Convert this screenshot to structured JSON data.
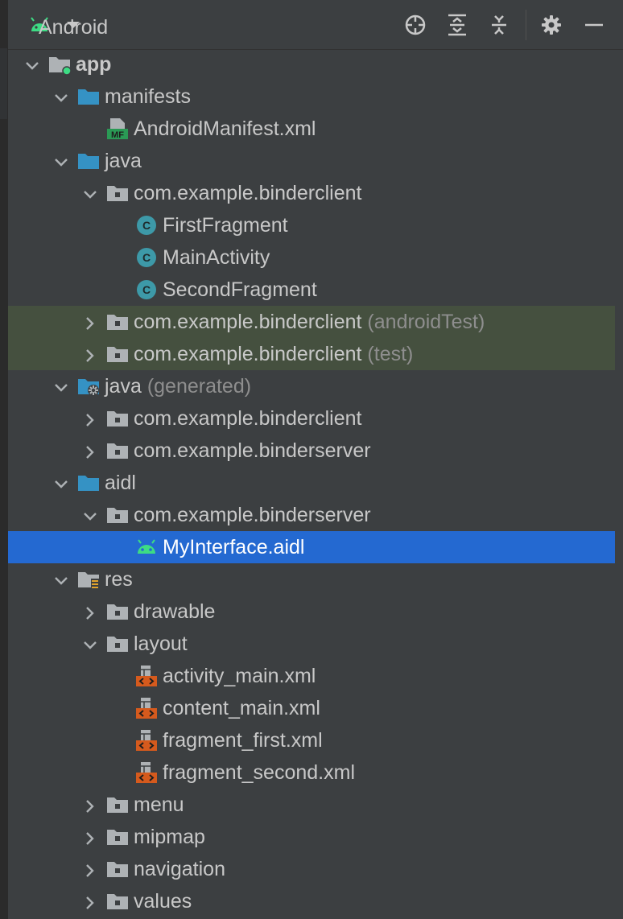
{
  "toolbar": {
    "view_label": "Android",
    "icons": [
      "locate-icon",
      "expand-all-icon",
      "collapse-all-icon",
      "gear-icon",
      "minimize-icon"
    ]
  },
  "tree": [
    {
      "label": "app",
      "suffix": "",
      "depth": 0,
      "toggle": "expanded",
      "icon": "module",
      "bold": true
    },
    {
      "label": "manifests",
      "suffix": "",
      "depth": 1,
      "toggle": "expanded",
      "icon": "folder"
    },
    {
      "label": "AndroidManifest.xml",
      "suffix": "",
      "depth": 2,
      "toggle": "none",
      "icon": "manifest"
    },
    {
      "label": "java",
      "suffix": "",
      "depth": 1,
      "toggle": "expanded",
      "icon": "folder"
    },
    {
      "label": "com.example.binderclient",
      "suffix": "",
      "depth": 2,
      "toggle": "expanded",
      "icon": "package"
    },
    {
      "label": "FirstFragment",
      "suffix": "",
      "depth": 3,
      "toggle": "none",
      "icon": "class"
    },
    {
      "label": "MainActivity",
      "suffix": "",
      "depth": 3,
      "toggle": "none",
      "icon": "class"
    },
    {
      "label": "SecondFragment",
      "suffix": "",
      "depth": 3,
      "toggle": "none",
      "icon": "class"
    },
    {
      "label": "com.example.binderclient",
      "suffix": "(androidTest)",
      "depth": 2,
      "toggle": "collapsed",
      "icon": "package",
      "test": true
    },
    {
      "label": "com.example.binderclient",
      "suffix": "(test)",
      "depth": 2,
      "toggle": "collapsed",
      "icon": "package",
      "test": true
    },
    {
      "label": "java",
      "suffix": "(generated)",
      "depth": 1,
      "toggle": "expanded",
      "icon": "generated"
    },
    {
      "label": "com.example.binderclient",
      "suffix": "",
      "depth": 2,
      "toggle": "collapsed",
      "icon": "package"
    },
    {
      "label": "com.example.binderserver",
      "suffix": "",
      "depth": 2,
      "toggle": "collapsed",
      "icon": "package"
    },
    {
      "label": "aidl",
      "suffix": "",
      "depth": 1,
      "toggle": "expanded",
      "icon": "folder"
    },
    {
      "label": "com.example.binderserver",
      "suffix": "",
      "depth": 2,
      "toggle": "expanded",
      "icon": "package"
    },
    {
      "label": "MyInterface.aidl",
      "suffix": "",
      "depth": 3,
      "toggle": "none",
      "icon": "android",
      "selected": true
    },
    {
      "label": "res",
      "suffix": "",
      "depth": 1,
      "toggle": "expanded",
      "icon": "res"
    },
    {
      "label": "drawable",
      "suffix": "",
      "depth": 2,
      "toggle": "collapsed",
      "icon": "package"
    },
    {
      "label": "layout",
      "suffix": "",
      "depth": 2,
      "toggle": "expanded",
      "icon": "package"
    },
    {
      "label": "activity_main.xml",
      "suffix": "",
      "depth": 3,
      "toggle": "none",
      "icon": "layout"
    },
    {
      "label": "content_main.xml",
      "suffix": "",
      "depth": 3,
      "toggle": "none",
      "icon": "layout"
    },
    {
      "label": "fragment_first.xml",
      "suffix": "",
      "depth": 3,
      "toggle": "none",
      "icon": "layout"
    },
    {
      "label": "fragment_second.xml",
      "suffix": "",
      "depth": 3,
      "toggle": "none",
      "icon": "layout"
    },
    {
      "label": "menu",
      "suffix": "",
      "depth": 2,
      "toggle": "collapsed",
      "icon": "package"
    },
    {
      "label": "mipmap",
      "suffix": "",
      "depth": 2,
      "toggle": "collapsed",
      "icon": "package"
    },
    {
      "label": "navigation",
      "suffix": "",
      "depth": 2,
      "toggle": "collapsed",
      "icon": "package"
    },
    {
      "label": "values",
      "suffix": "",
      "depth": 2,
      "toggle": "collapsed",
      "icon": "package"
    }
  ],
  "colors": {
    "background": "#3c3f41",
    "selected": "#2469d1",
    "test_row": "#45503f",
    "folder": "#3592c4",
    "package": "#aeb2b5",
    "class": "#3d99a8",
    "android": "#3ddc84",
    "layout_badge": "#d55a1d"
  }
}
